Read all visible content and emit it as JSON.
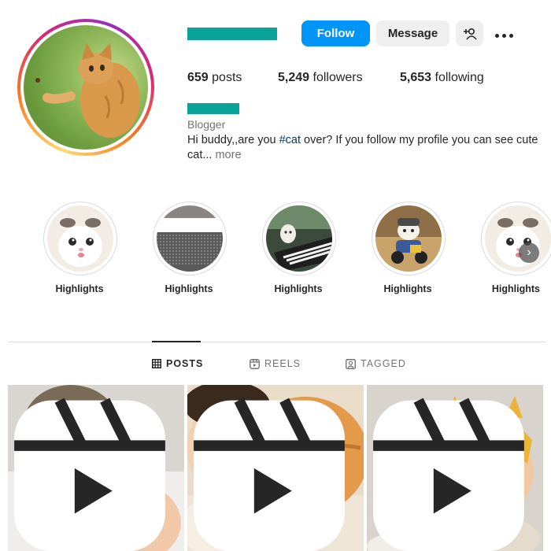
{
  "profile": {
    "follow_label": "Follow",
    "message_label": "Message",
    "stats": [
      {
        "count": "659",
        "label": "posts"
      },
      {
        "count": "5,249",
        "label": "followers"
      },
      {
        "count": "5,653",
        "label": "following"
      }
    ],
    "category": "Blogger",
    "bio_prefix": "Hi buddy,,are you ",
    "bio_hashtag": "#cat",
    "bio_suffix": " over? If you follow my profile you can see cute cat...",
    "bio_more": "more"
  },
  "highlights": [
    {
      "label": "Highlights",
      "icon": "white-kitten"
    },
    {
      "label": "Highlights",
      "icon": "static-pattern"
    },
    {
      "label": "Highlights",
      "icon": "piano-cat"
    },
    {
      "label": "Highlights",
      "icon": "scooter-cat"
    },
    {
      "label": "Highlights",
      "icon": "white-kitten"
    }
  ],
  "tabs": [
    {
      "label": "POSTS",
      "icon": "grid-icon",
      "active": true
    },
    {
      "label": "REELS",
      "icon": "reels-icon",
      "active": false
    },
    {
      "label": "TAGGED",
      "icon": "tagged-icon",
      "active": false
    }
  ],
  "posts": [
    {
      "subject": "cat-washing-baby",
      "type": "reel"
    },
    {
      "subject": "baby-sleeping-with-orange-cat",
      "type": "reel"
    },
    {
      "subject": "kitten-and-baby-in-knit-hats",
      "type": "reel"
    }
  ],
  "colors": {
    "accent": "#0095f6",
    "redacted": "#0aa39a",
    "hashtag": "#00376b",
    "secondary_text": "#737373"
  }
}
